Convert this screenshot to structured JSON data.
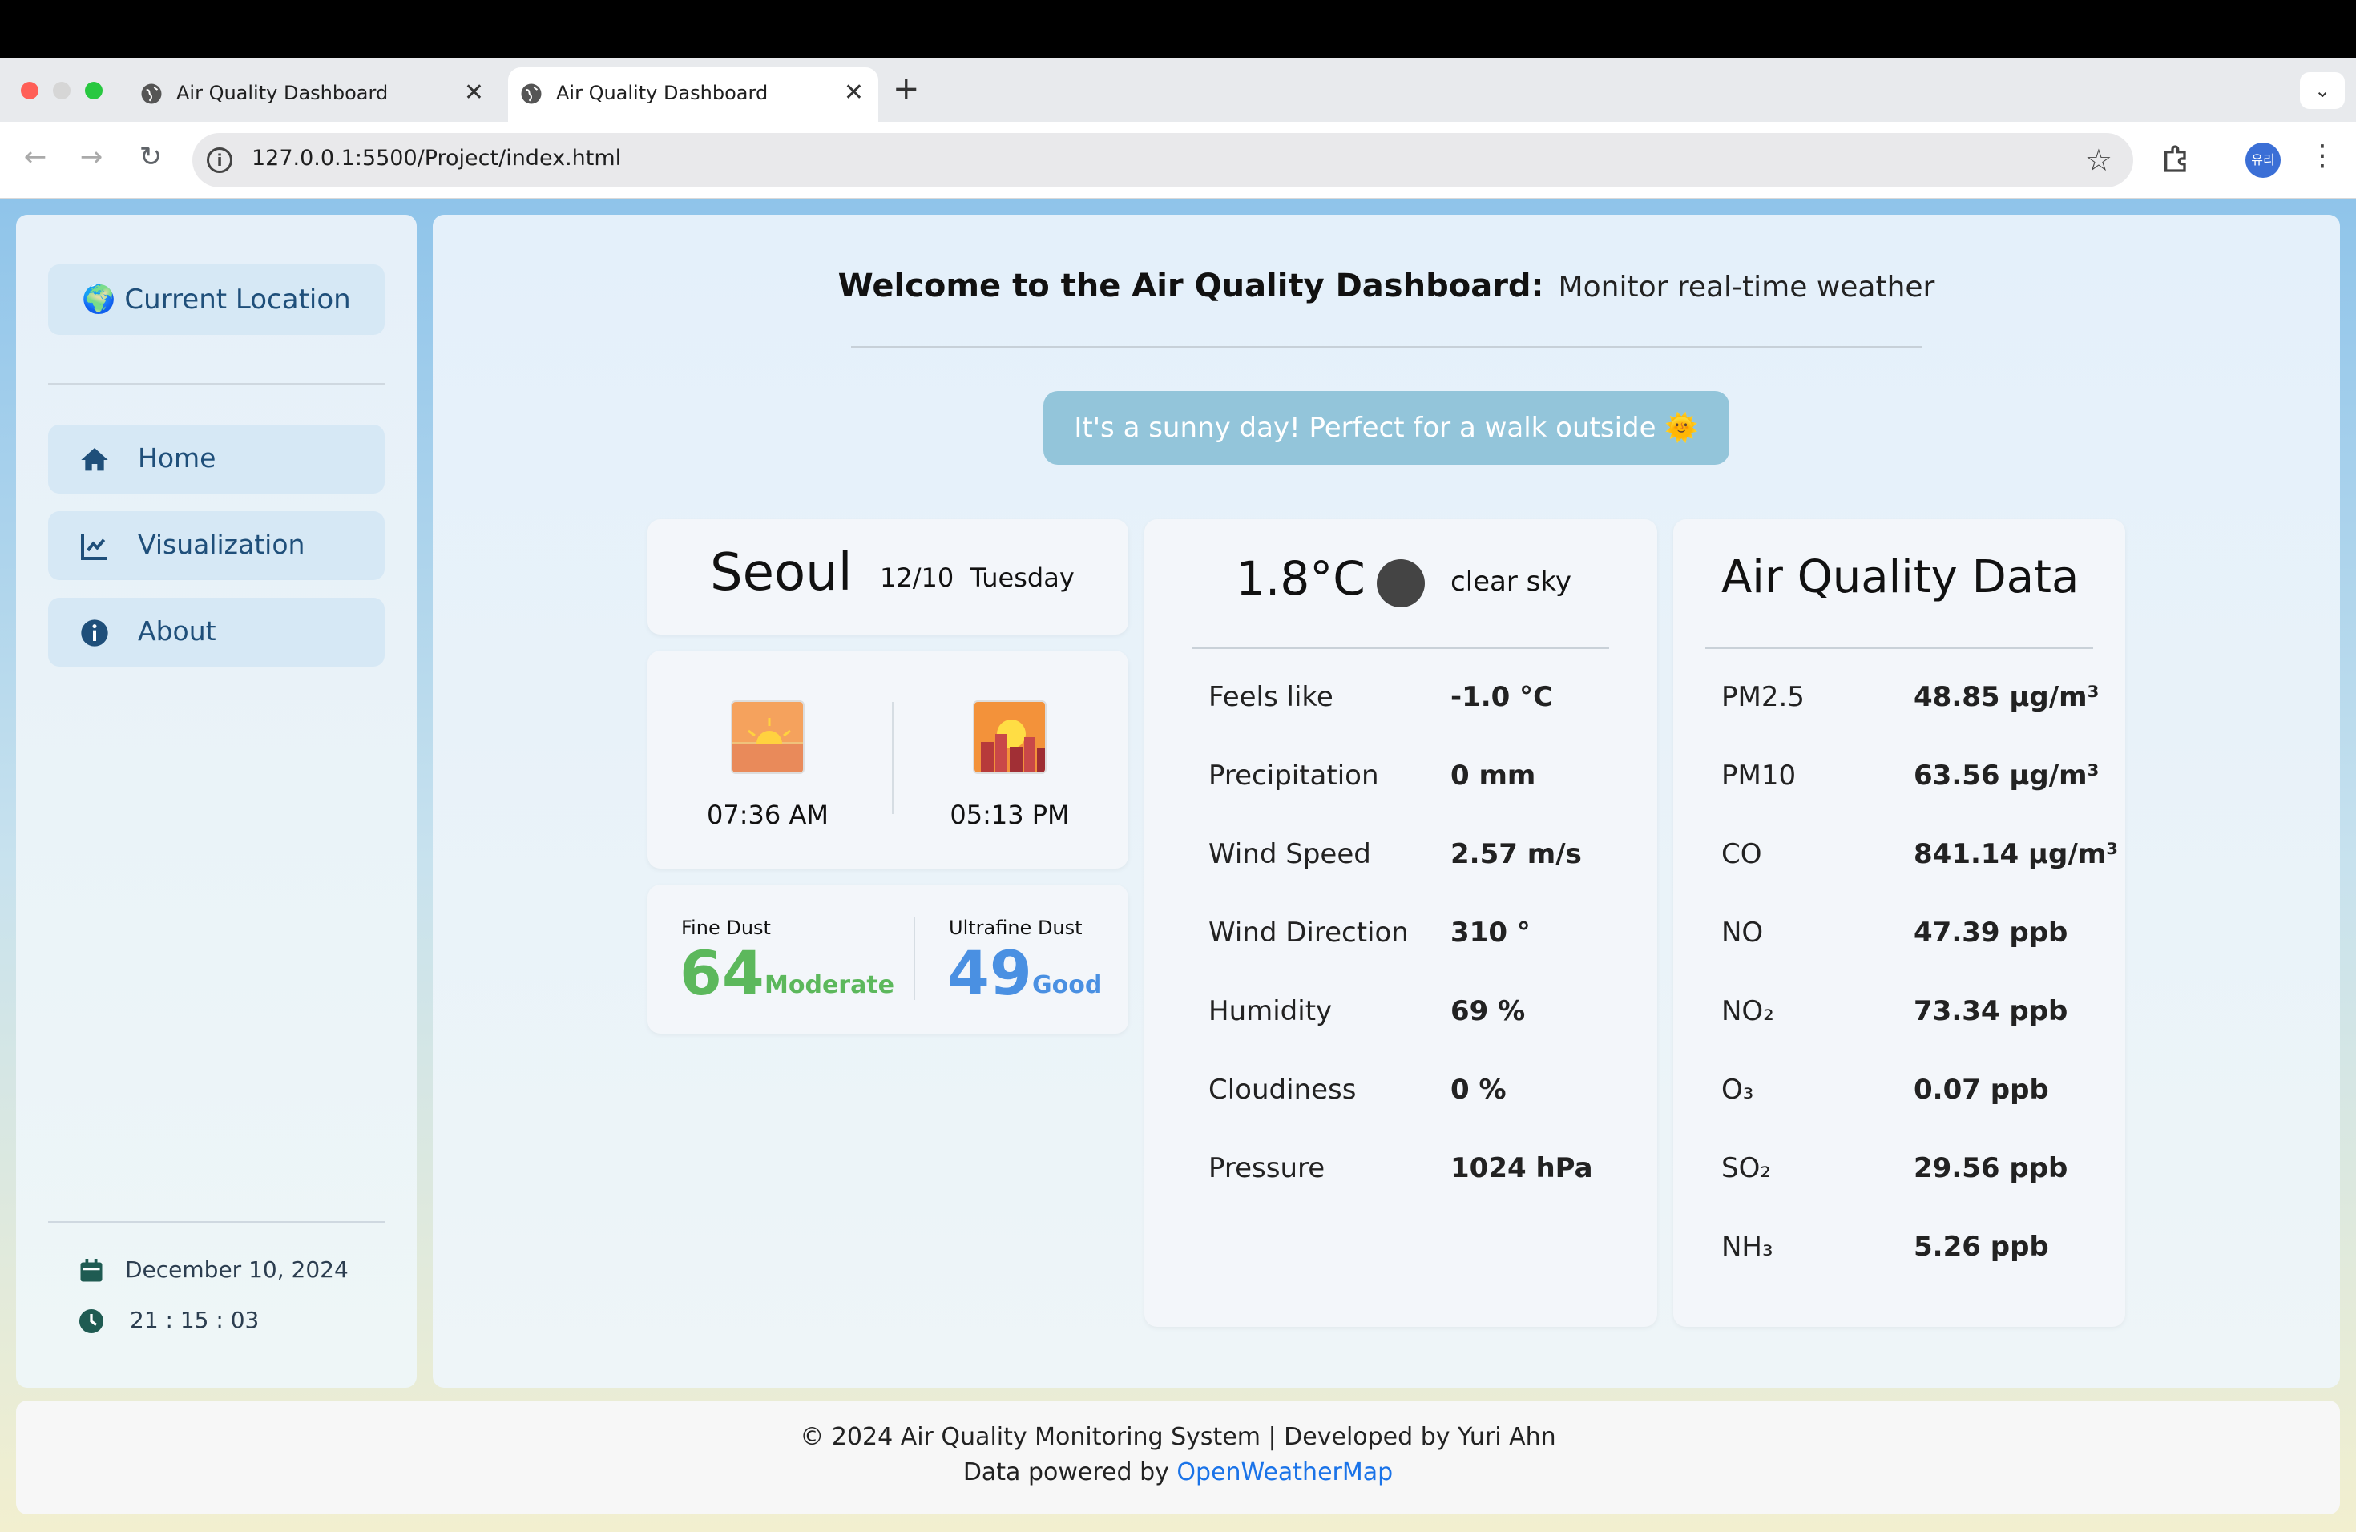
{
  "browser": {
    "tabs": [
      {
        "title": "Air Quality Dashboard",
        "active": false
      },
      {
        "title": "Air Quality Dashboard",
        "active": true
      }
    ],
    "new_tab": "+",
    "close": "✕",
    "url": "127.0.0.1:5500/Project/index.html",
    "profile_initials": "유리"
  },
  "sidebar": {
    "location_button": "🌍 Current Location",
    "nav": [
      {
        "label": "Home",
        "icon": "home-icon"
      },
      {
        "label": "Visualization",
        "icon": "chart-line-icon"
      },
      {
        "label": "About",
        "icon": "info-icon"
      }
    ],
    "date": "December 10, 2024",
    "time": "21 : 15 : 03"
  },
  "header": {
    "title": "Welcome to the Air Quality Dashboard:",
    "subtitle": "Monitor real-time weather"
  },
  "tip": "It's a sunny day! Perfect for a walk outside 🌞",
  "city_card": {
    "city": "Seoul",
    "date": "12/10",
    "weekday": "Tuesday"
  },
  "sun_card": {
    "sunrise": "07:36 AM",
    "sunset": "05:13 PM"
  },
  "dust_card": {
    "fine": {
      "label": "Fine Dust",
      "value": "64",
      "status": "Moderate",
      "color": "#5cb85c"
    },
    "ultrafine": {
      "label": "Ultrafine Dust",
      "value": "49",
      "status": "Good",
      "color": "#4a90e2"
    }
  },
  "weather_card": {
    "temperature": "1.8°C",
    "description": "clear sky",
    "rows": [
      {
        "label": "Feels like",
        "value": "-1.0 °C"
      },
      {
        "label": "Precipitation",
        "value": "0 mm"
      },
      {
        "label": "Wind Speed",
        "value": "2.57 m/s"
      },
      {
        "label": "Wind Direction",
        "value": "310 °"
      },
      {
        "label": "Humidity",
        "value": "69 %"
      },
      {
        "label": "Cloudiness",
        "value": "0 %"
      },
      {
        "label": "Pressure",
        "value": "1024 hPa"
      }
    ]
  },
  "air_card": {
    "title": "Air Quality Data",
    "rows": [
      {
        "label": "PM2.5",
        "value": "48.85 μg/m³"
      },
      {
        "label": "PM10",
        "value": "63.56 μg/m³"
      },
      {
        "label": "CO",
        "value": "841.14 μg/m³"
      },
      {
        "label": "NO",
        "value": "47.39 ppb"
      },
      {
        "label": "NO₂",
        "value": "73.34 ppb"
      },
      {
        "label": "O₃",
        "value": "0.07 ppb"
      },
      {
        "label": "SO₂",
        "value": "29.56 ppb"
      },
      {
        "label": "NH₃",
        "value": "5.26 ppb"
      }
    ]
  },
  "footer": {
    "line1": "© 2024 Air Quality Monitoring System | Developed by Yuri Ahn",
    "line2_prefix": "Data powered by ",
    "link": "OpenWeatherMap"
  }
}
